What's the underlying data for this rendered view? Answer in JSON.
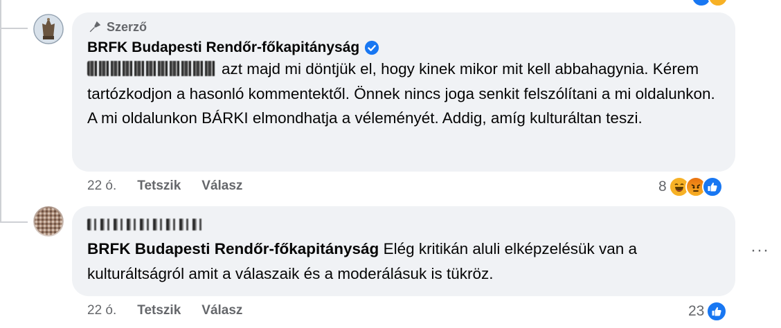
{
  "comments": [
    {
      "author_badge": "Szerző",
      "author_name": "BRFK Budapesti Rendőr-főkapitányság",
      "verified": true,
      "mention_redacted": true,
      "text": "azt majd mi döntjük el, hogy kinek mikor mit kell abbahagynia. Kérem tartózkodjon a hasonló kommentektől. Önnek nincs joga senkit felszólítani a mi oldalunkon. A mi oldalunkon BÁRKI elmondhatja a véleményét. Addig, amíg kulturáltan teszi.",
      "time": "22 ó.",
      "like_label": "Tetszik",
      "reply_label": "Válasz",
      "reaction_count": "8",
      "reactions": [
        "haha-icon",
        "angry-icon",
        "like-icon"
      ]
    },
    {
      "author_name_redacted": true,
      "mention": "BRFK Budapesti Rendőr-főkapitányság",
      "text": "Elég kritikán aluli elképzelésük van a kulturáltságról amit a válaszaik és a moderálásuk is tükröz.",
      "time": "22 ó.",
      "like_label": "Tetszik",
      "reply_label": "Válasz",
      "reaction_count": "23",
      "reactions": [
        "like-icon"
      ],
      "more_label": "···"
    }
  ],
  "colors": {
    "bubble": "#f0f2f5",
    "meta_text": "#65676b",
    "like_blue": "#1877f2",
    "haha_yellow": "#f7b125",
    "angry_orange": "#e9710f"
  }
}
